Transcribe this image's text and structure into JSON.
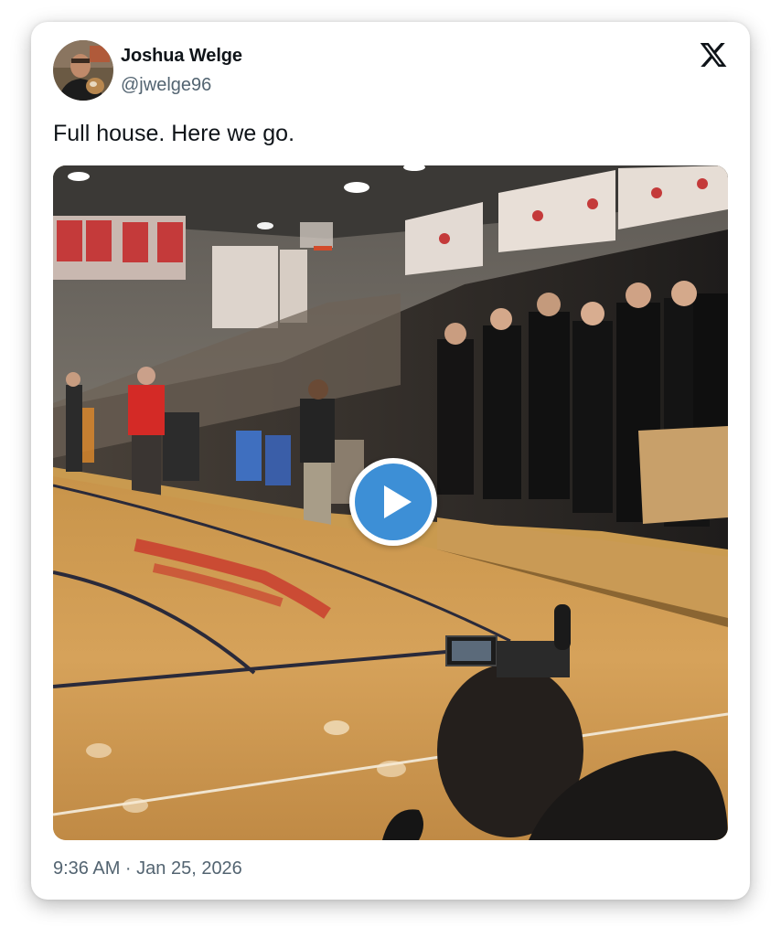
{
  "author": {
    "name": "Joshua Welge",
    "handle": "@jwelge96"
  },
  "tweet": {
    "text": "Full house. Here we go.",
    "timestamp": "9:36 AM · Jan 25, 2026"
  },
  "icons": {
    "platform": "x-logo-icon",
    "play": "play-icon"
  },
  "colors": {
    "text_primary": "#0f1419",
    "text_secondary": "#536471",
    "play_button": "#3d8fd6"
  }
}
